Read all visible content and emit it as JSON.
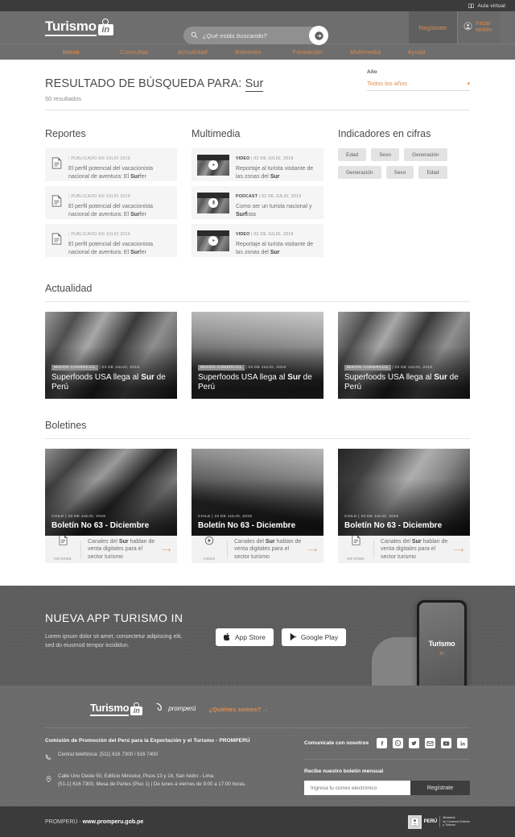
{
  "topbar": {
    "aula_label": "Aula virtual",
    "aula_icon": "book-icon"
  },
  "header": {
    "logo_word": "Turismo",
    "logo_mark": "in",
    "search": {
      "placeholder": "¿Qué estás buscando?",
      "icon": "search-icon",
      "submit_icon": "arrow-submit-icon"
    },
    "register_label": "Regístrate",
    "login_label": "Iniciar sesión",
    "login_icon": "user-circle-icon"
  },
  "nav": {
    "items": [
      {
        "label": "Inicio",
        "active": true
      },
      {
        "label": "Consultas",
        "active": false
      },
      {
        "label": "Actualidad",
        "active": false
      },
      {
        "label": "Boletines",
        "active": false
      },
      {
        "label": "Formación",
        "active": false
      },
      {
        "label": "Multimedia",
        "active": false
      },
      {
        "label": "Ayuda",
        "active": false
      }
    ]
  },
  "results": {
    "title_prefix": "RESULTADO DE BÚSQUEDA PARA:",
    "term": "Sur",
    "count": "50 resultados"
  },
  "year_filter": {
    "label": "Año",
    "value": "Todos los años",
    "caret": "chevron-down-icon"
  },
  "reportes": {
    "title": "Reportes",
    "items": [
      {
        "meta": "PUBLICADO EN JULIO 2019",
        "text_a": "El perfil potencial del vacacionista nacional de aventura: El ",
        "text_b": "Sur",
        "text_c": "fer",
        "icon": "document-icon"
      },
      {
        "meta": "PUBLICADO EN JULIO 2019",
        "text_a": "El perfil potencial del vacacionista nacional de aventura: El ",
        "text_b": "Sur",
        "text_c": "fer",
        "icon": "document-icon"
      },
      {
        "meta": "PUBLICADO EN JULIO 2019",
        "text_a": "El perfil potencial del vacacionista nacional de aventura: El ",
        "text_b": "Sur",
        "text_c": "fer",
        "icon": "document-icon"
      }
    ]
  },
  "multimedia": {
    "title": "Multimedia",
    "items": [
      {
        "type": "VIDEO",
        "date": "02 DE JULIO, 2019",
        "text_a": "Reportaje al turista visitante de las zonas del ",
        "text_b": "Sur",
        "text_c": "",
        "icon": "play-icon"
      },
      {
        "type": "PODCAST",
        "date": "02 DE JULIO, 2019",
        "text_a": "Como ser un turista nacional y ",
        "text_b": "Surf",
        "text_c": "ista",
        "icon": "microphone-icon"
      },
      {
        "type": "VIDEO",
        "date": "02 DE JULIO, 2019",
        "text_a": "Reportaje al turista visitante de las zonas del ",
        "text_b": "Sur",
        "text_c": "",
        "icon": "play-icon"
      }
    ]
  },
  "indicadores": {
    "title": "Indicadores en cifras",
    "tags": [
      "Edad",
      "Sexo",
      "Generación",
      "Generación",
      "Sexo",
      "Edad"
    ]
  },
  "actualidad": {
    "title": "Actualidad",
    "cards": [
      {
        "tag": "MISIÓN COMERCIAL",
        "date": "03 DE JULIO, 2019",
        "title_a": "Superfoods USA llega al ",
        "title_b": "Sur",
        "title_c": " de Perú"
      },
      {
        "tag": "MISIÓN COMERCIAL",
        "date": "03 DE JULIO, 2019",
        "title_a": "Superfoods USA llega al ",
        "title_b": "Sur",
        "title_c": " de Perú"
      },
      {
        "tag": "MISIÓN COMERCIAL",
        "date": "03 DE JULIO, 2019",
        "title_a": "Superfoods USA llega al ",
        "title_b": "Sur",
        "title_c": " de Perú"
      }
    ]
  },
  "boletines": {
    "title": "Boletines",
    "cards": [
      {
        "country": "CHILE",
        "date": "23 DE JULIO, 2019",
        "title": "Boletín No 63 - Diciembre",
        "type_label": "INFORME",
        "type_icon": "document-icon",
        "desc_a": "Canales del ",
        "desc_b": "Sur",
        "desc_c": " hablan de venta digitales para el sector turismo",
        "arrow": "arrow-right-icon"
      },
      {
        "country": "CHILE",
        "date": "23 DE JULIO, 2019",
        "title": "Boletín No 63 - Diciembre",
        "type_label": "VIDEO",
        "type_icon": "play-icon",
        "desc_a": "Canales del ",
        "desc_b": "Sur",
        "desc_c": " hablan de venta digitales para el sector turismo",
        "arrow": "arrow-right-icon"
      },
      {
        "country": "CHILE",
        "date": "23 DE JULIO, 2019",
        "title": "Boletín No 63 - Diciembre",
        "type_label": "INFORME",
        "type_icon": "document-icon",
        "desc_a": "Canales del ",
        "desc_b": "Sur",
        "desc_c": " hablan de venta digitales para el sector turismo",
        "arrow": "arrow-right-icon"
      }
    ]
  },
  "app_banner": {
    "title": "NUEVA APP TURISMO IN",
    "description": "Lorem ipsum dolor sit amet, consectetur adipiscing elit, sed do eiusmod tempor incididun.",
    "appstore_label": "App Store",
    "appstore_icon": "apple-icon",
    "googleplay_label": "Google Play",
    "googleplay_icon": "google-play-icon",
    "phone_logo": "Turismo",
    "phone_mark": "in"
  },
  "footer": {
    "logo_word": "Turismo",
    "logo_mark": "in",
    "promperu_label": "promperú",
    "quienes_somos": "¿Quiénes somos?",
    "org_name": "Comisión de Promoción del Perú para la Exportación y el Turismo - PROMPERÚ",
    "phone_icon": "phone-icon",
    "phone_text": "Central telefónica: (511) 616 7300 / 616 7400",
    "address_icon": "location-icon",
    "address_text": "Calle Uno Oeste 50, Edificio Mincetur, Pisos 13 y 14, San Isidro - Lima",
    "address_text2": "(51-1) 616 7300, Mesa de Partes (Piso 1) | De lunes a viernes de 9:00 a 17:00 horas.",
    "social_label": "Comunícate con nosotros",
    "socials": [
      "facebook-icon",
      "whatsapp-icon",
      "twitter-icon",
      "mail-icon",
      "youtube-icon",
      "linkedin-icon"
    ],
    "newsletter_label": "Recibe nuestro boletín mensual",
    "newsletter_placeholder": "Ingresa tu correo electrónico",
    "newsletter_button": "Regístrate"
  },
  "bottombar": {
    "text_a": "PROMPERÚ - ",
    "text_b": "www.promperu.gob.pe",
    "peru_label": "PERÚ",
    "ministry_line1": "Ministerio",
    "ministry_line2": "de Comercio Exterior",
    "ministry_line3": "y Turismo"
  },
  "colors": {
    "accent": "#e08d4e",
    "header_bg": "#6e6e6e",
    "dark_bar": "#3b3b3b",
    "panel_bg": "#f5f5f5"
  }
}
